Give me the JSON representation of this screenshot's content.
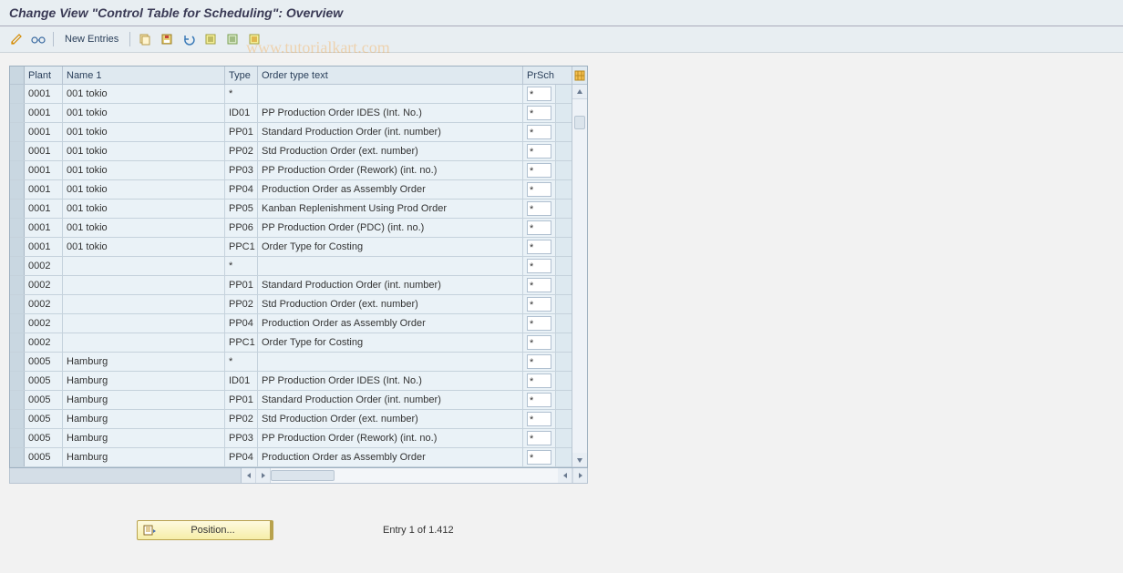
{
  "header": {
    "title": "Change View \"Control Table for Scheduling\": Overview"
  },
  "toolbar": {
    "new_entries": "New Entries"
  },
  "table": {
    "columns": {
      "plant": "Plant",
      "name1": "Name 1",
      "type": "Type",
      "order_type_text": "Order type text",
      "prsch": "PrSch"
    },
    "rows": [
      {
        "plant": "0001",
        "name1": "001 tokio",
        "type": "*",
        "text": "",
        "prsch": "*"
      },
      {
        "plant": "0001",
        "name1": "001 tokio",
        "type": "ID01",
        "text": "PP Production Order IDES      (Int. No.)",
        "prsch": "*"
      },
      {
        "plant": "0001",
        "name1": "001 tokio",
        "type": "PP01",
        "text": "Standard Production Order (int. number)",
        "prsch": "*"
      },
      {
        "plant": "0001",
        "name1": "001 tokio",
        "type": "PP02",
        "text": "Std Production Order (ext. number)",
        "prsch": "*"
      },
      {
        "plant": "0001",
        "name1": "001 tokio",
        "type": "PP03",
        "text": "PP Production Order (Rework)  (int. no.)",
        "prsch": "*"
      },
      {
        "plant": "0001",
        "name1": "001 tokio",
        "type": "PP04",
        "text": "Production Order as Assembly Order",
        "prsch": "*"
      },
      {
        "plant": "0001",
        "name1": "001 tokio",
        "type": "PP05",
        "text": "Kanban Replenishment Using Prod Order",
        "prsch": "*"
      },
      {
        "plant": "0001",
        "name1": "001 tokio",
        "type": "PP06",
        "text": "PP Production Order (PDC)      (int. no.)",
        "prsch": "*"
      },
      {
        "plant": "0001",
        "name1": "001 tokio",
        "type": "PPC1",
        "text": "Order Type for Costing",
        "prsch": "*"
      },
      {
        "plant": "0002",
        "name1": "",
        "type": "*",
        "text": "",
        "prsch": "*"
      },
      {
        "plant": "0002",
        "name1": "",
        "type": "PP01",
        "text": "Standard Production Order (int. number)",
        "prsch": "*"
      },
      {
        "plant": "0002",
        "name1": "",
        "type": "PP02",
        "text": "Std Production Order (ext. number)",
        "prsch": "*"
      },
      {
        "plant": "0002",
        "name1": "",
        "type": "PP04",
        "text": "Production Order as Assembly Order",
        "prsch": "*"
      },
      {
        "plant": "0002",
        "name1": "",
        "type": "PPC1",
        "text": "Order Type for Costing",
        "prsch": "*"
      },
      {
        "plant": "0005",
        "name1": "Hamburg",
        "type": "*",
        "text": "",
        "prsch": "*"
      },
      {
        "plant": "0005",
        "name1": "Hamburg",
        "type": "ID01",
        "text": "PP Production Order IDES      (Int. No.)",
        "prsch": "*"
      },
      {
        "plant": "0005",
        "name1": "Hamburg",
        "type": "PP01",
        "text": "Standard Production Order (int. number)",
        "prsch": "*"
      },
      {
        "plant": "0005",
        "name1": "Hamburg",
        "type": "PP02",
        "text": "Std Production Order (ext. number)",
        "prsch": "*"
      },
      {
        "plant": "0005",
        "name1": "Hamburg",
        "type": "PP03",
        "text": "PP Production Order (Rework)  (int. no.)",
        "prsch": "*"
      },
      {
        "plant": "0005",
        "name1": "Hamburg",
        "type": "PP04",
        "text": "Production Order as Assembly Order",
        "prsch": "*"
      }
    ]
  },
  "footer": {
    "position_label": "Position...",
    "entry_label": "Entry 1 of 1.412"
  },
  "watermark": "www.tutorialkart.com"
}
